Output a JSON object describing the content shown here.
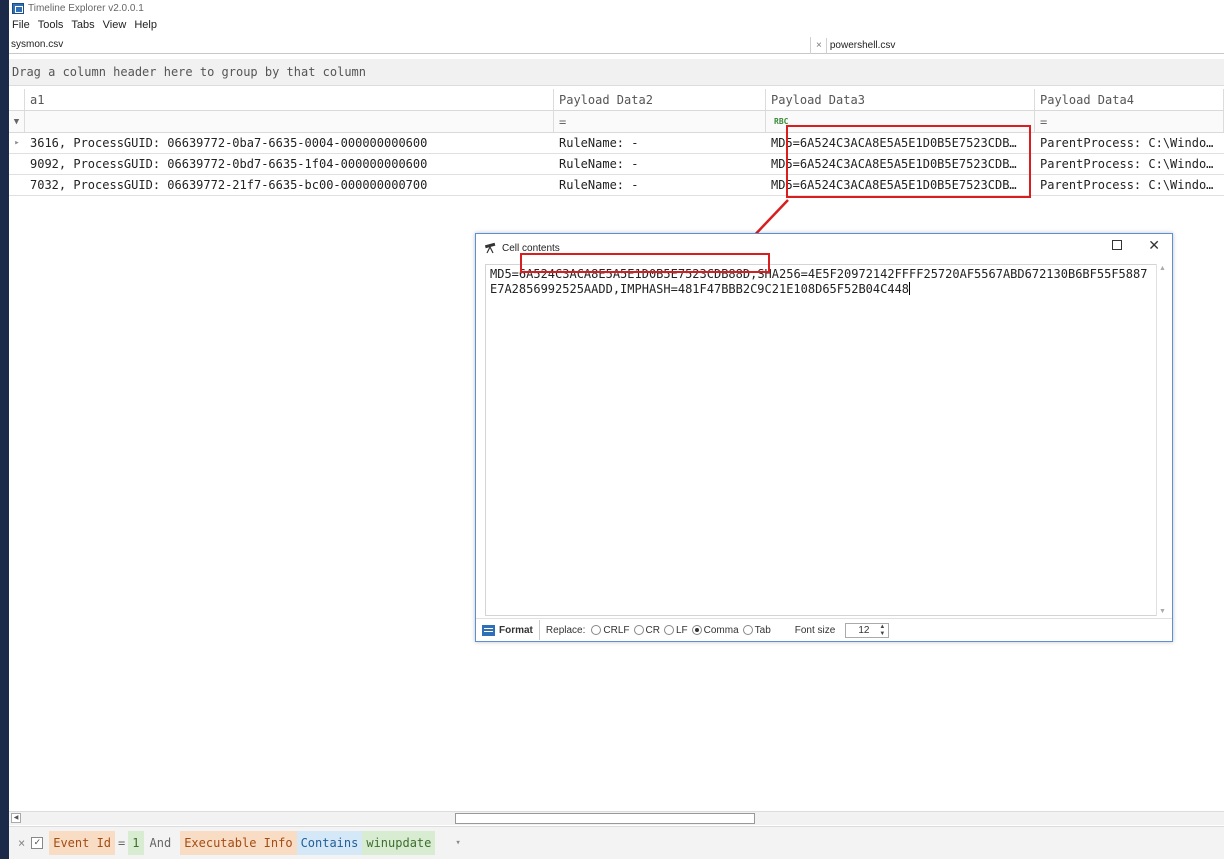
{
  "app": {
    "title": "Timeline Explorer v2.0.0.1"
  },
  "menu": [
    "File",
    "Tools",
    "Tabs",
    "View",
    "Help"
  ],
  "tabs": [
    {
      "label": "sysmon.csv",
      "active": true
    },
    {
      "label": "powershell.csv",
      "active": false,
      "close": "×"
    }
  ],
  "group_panel": {
    "hint": "Drag a column header here to group by that column"
  },
  "grid": {
    "columns": [
      "a1",
      "Payload Data2",
      "Payload Data3",
      "Payload Data4"
    ],
    "filter_symbols": [
      "=",
      "=",
      "=",
      "="
    ],
    "rows": [
      {
        "c1": "3616, ProcessGUID: 06639772-0ba7-6635-0004-000000000600",
        "c2": "RuleName: -",
        "c3": "MD5=6A524C3ACA8E5A5E1D0B5E7523CDB…",
        "c4": "ParentProcess: C:\\Windo…"
      },
      {
        "c1": "9092, ProcessGUID: 06639772-0bd7-6635-1f04-000000000600",
        "c2": "RuleName: -",
        "c3": "MD5=6A524C3ACA8E5A5E1D0B5E7523CDB…",
        "c4": "ParentProcess: C:\\Windo…"
      },
      {
        "c1": "7032, ProcessGUID: 06639772-21f7-6635-bc00-000000000700",
        "c2": "RuleName: -",
        "c3": "MD5=6A524C3ACA8E5A5E1D0B5E7523CDB…",
        "c4": "ParentProcess: C:\\Windo…"
      }
    ]
  },
  "dialog": {
    "title": "Cell contents",
    "text_prefix": "MD5=",
    "text_md5": "6A524C3ACA8E5A5E1D0B5E7523CDB88D",
    "text_rest": ",SHA256=4E5F20972142FFFF25720AF5567ABD672130B6BF55F5887E7A2856992525AADD,IMPHASH=481F47BBB2C9C21E108D65F52B04C448",
    "format_label": "Format",
    "replace_label": "Replace:",
    "replace_options": [
      {
        "label": "CRLF",
        "selected": false
      },
      {
        "label": "CR",
        "selected": false
      },
      {
        "label": "LF",
        "selected": false
      },
      {
        "label": "Comma",
        "selected": true
      },
      {
        "label": "Tab",
        "selected": false
      }
    ],
    "font_size_label": "Font size",
    "font_size_value": "12"
  },
  "filter_bar": {
    "clear": "×",
    "check": "✓",
    "field1": "Event Id",
    "op1": "=",
    "value1": "1",
    "joiner": "And",
    "field2": "Executable Info",
    "op2": "Contains",
    "value2": "winupdate",
    "dropdown": "▾"
  },
  "colors": {
    "highlight_red": "#d81e1e",
    "chip_orange": "#f9dcc4",
    "chip_blue": "#d5e8f7",
    "chip_green": "#d8ecd2"
  }
}
